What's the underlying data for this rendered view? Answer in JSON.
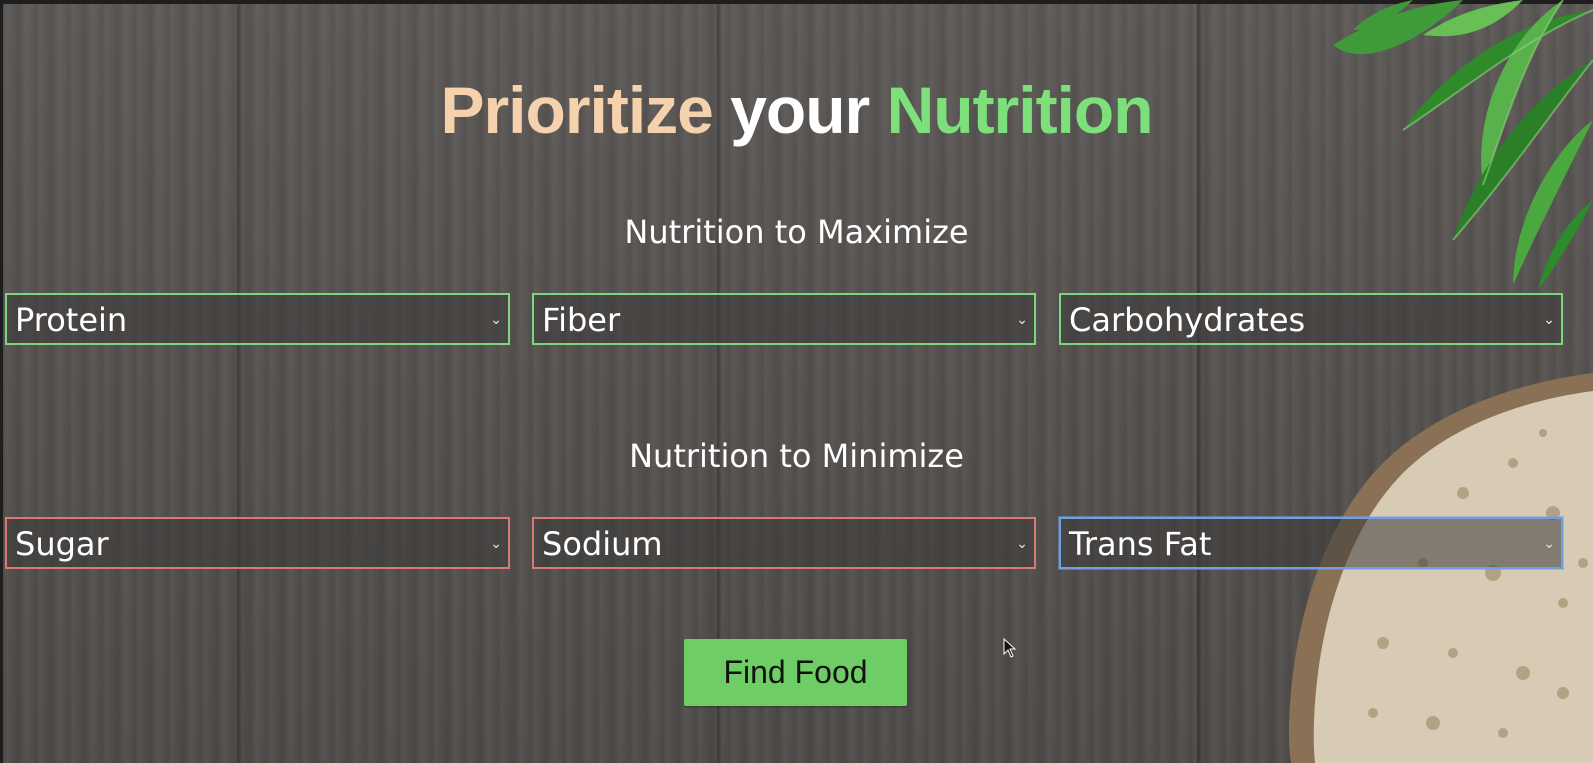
{
  "title": {
    "word1": "Prioritize",
    "word2": "your",
    "word3": "Nutrition",
    "colors": {
      "word1": "#f6d1ad",
      "word2": "#ffffff",
      "word3": "#7de07a"
    }
  },
  "maximize": {
    "label": "Nutrition to Maximize",
    "selects": [
      {
        "value": "Protein"
      },
      {
        "value": "Fiber"
      },
      {
        "value": "Carbohydrates"
      }
    ],
    "border_color": "#7fd57a"
  },
  "minimize": {
    "label": "Nutrition to Minimize",
    "selects": [
      {
        "value": "Sugar"
      },
      {
        "value": "Sodium"
      },
      {
        "value": "Trans Fat"
      }
    ],
    "border_color": "#d87a72"
  },
  "focus_color": "#6f9fe0",
  "button": {
    "label": "Find Food",
    "color": "#6fcd66"
  },
  "icons": {
    "dropdown": "chevron-down-icon",
    "pointer": "mouse-cursor-icon"
  }
}
